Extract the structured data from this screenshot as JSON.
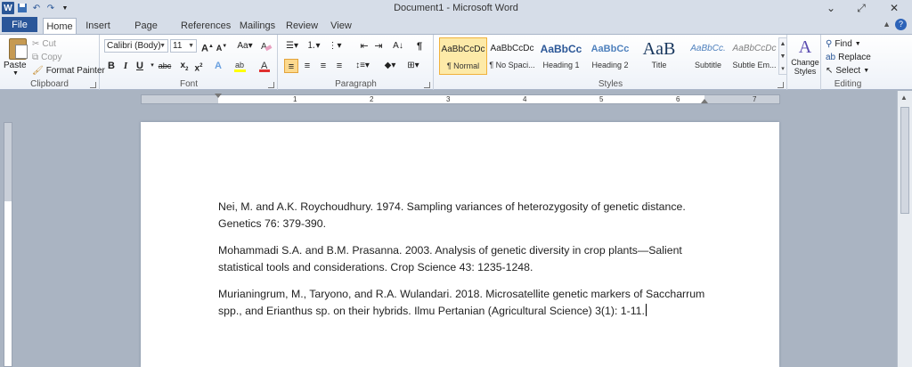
{
  "window": {
    "title": "Document1 - Microsoft Word",
    "minimize_glyph": "⌄",
    "restore_glyph": "⤢",
    "close_glyph": "✕"
  },
  "tabs": [
    "File",
    "Home",
    "Insert",
    "Page Layout",
    "References",
    "Mailings",
    "Review",
    "View"
  ],
  "clipboard": {
    "paste": "Paste",
    "cut": "Cut",
    "copy": "Copy",
    "format_painter": "Format Painter",
    "label": "Clipboard"
  },
  "font": {
    "family": "Calibri (Body)",
    "size": "11",
    "label": "Font"
  },
  "paragraph": {
    "label": "Paragraph"
  },
  "styles": {
    "label": "Styles",
    "items": [
      {
        "sample": "AaBbCcDc",
        "name": "¶ Normal"
      },
      {
        "sample": "AaBbCcDc",
        "name": "¶ No Spaci..."
      },
      {
        "sample": "AaBbCc",
        "name": "Heading 1"
      },
      {
        "sample": "AaBbCc",
        "name": "Heading 2"
      },
      {
        "sample": "AaB",
        "name": "Title"
      },
      {
        "sample": "AaBbCc.",
        "name": "Subtitle"
      },
      {
        "sample": "AaBbCcDc",
        "name": "Subtle Em..."
      }
    ],
    "change_styles": "Change Styles"
  },
  "editing": {
    "find": "Find",
    "replace": "Replace",
    "select": "Select",
    "label": "Editing"
  },
  "ruler_numbers": [
    "1",
    "2",
    "3",
    "4",
    "5",
    "6",
    "7"
  ],
  "document": {
    "paragraphs": [
      "Nei, M. and A.K. Roychoudhury. 1974. Sampling variances of heterozygosity of genetic distance. Genetics 76: 379-390.",
      "Mohammadi S.A. and B.M. Prasanna. 2003. Analysis of genetic diversity in crop plants—Salient statistical tools and considerations. Crop Science 43: 1235-1248.",
      "Murianingrum, M., Taryono, and R.A. Wulandari. 2018. Microsatellite genetic markers of Saccharrum spp., and Erianthus sp. on their hybrids. Ilmu Pertanian (Agricultural Science) 3(1): 1-11."
    ]
  },
  "colors": {
    "file_tab": "#2a5699",
    "highlight": "#fcd98d",
    "font_color": "#e03030",
    "highlighter": "#ffff00"
  }
}
